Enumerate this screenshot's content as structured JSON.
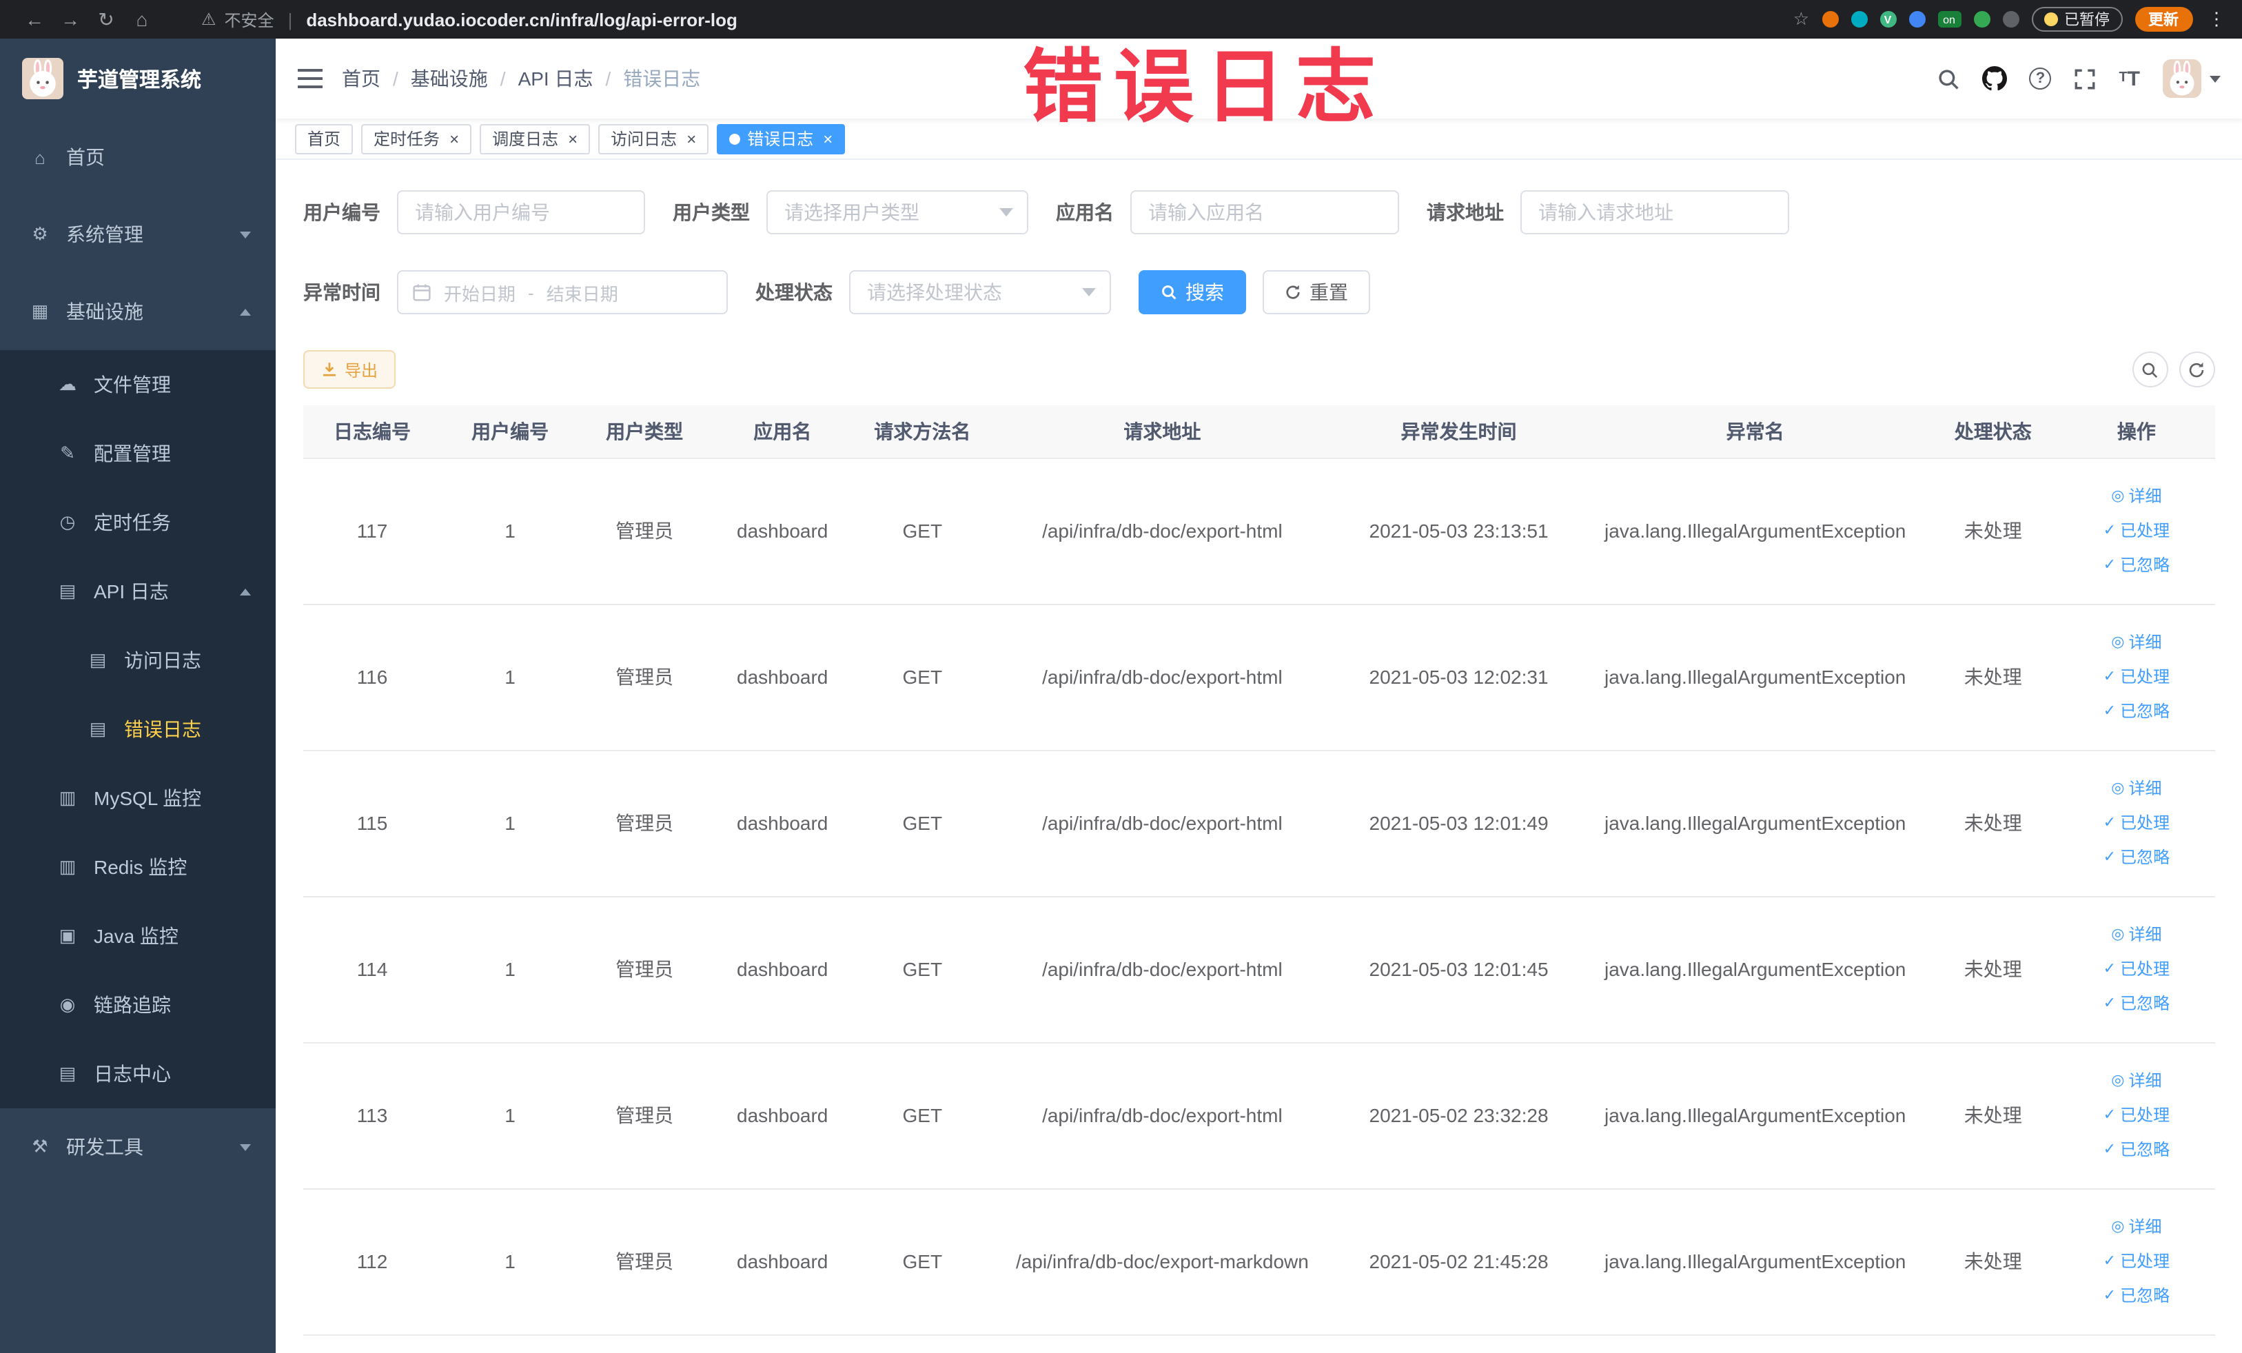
{
  "colors": {
    "accent": "#409eff",
    "watermark": "#f13a4e",
    "warning": "#e6a23c",
    "sidebar_bg": "#304156",
    "submenu_bg": "#1f2d3d",
    "menu_active": "#ffd04b"
  },
  "overlay": {
    "watermark": "错误日志"
  },
  "browser": {
    "security_label": "不安全",
    "url": "dashboard.yudao.iocoder.cn/infra/log/api-error-log",
    "extension_badge_on": "on",
    "paused_badge": "已暂停",
    "update_button": "更新"
  },
  "sidebar": {
    "logo_title": "芋道管理系统",
    "menu": [
      {
        "key": "home",
        "label": "首页",
        "icon": "home",
        "level": 1
      },
      {
        "key": "system-management",
        "label": "系统管理",
        "icon": "gear",
        "level": 1,
        "chevron": "down"
      },
      {
        "key": "infrastructure",
        "label": "基础设施",
        "icon": "grid",
        "level": 1,
        "chevron": "up"
      },
      {
        "key": "file-management",
        "label": "文件管理",
        "icon": "cloud",
        "level": 2,
        "sub": true
      },
      {
        "key": "config-management",
        "label": "配置管理",
        "icon": "edit",
        "level": 2,
        "sub": true
      },
      {
        "key": "scheduled-tasks",
        "label": "定时任务",
        "icon": "clock",
        "level": 2,
        "sub": true
      },
      {
        "key": "api-logs",
        "label": "API 日志",
        "icon": "doc",
        "level": 2,
        "sub": true,
        "chevron": "up"
      },
      {
        "key": "access-logs",
        "label": "访问日志",
        "icon": "doc",
        "level": 3,
        "sub": true
      },
      {
        "key": "error-logs",
        "label": "错误日志",
        "icon": "doc",
        "level": 3,
        "sub": true,
        "active": true
      },
      {
        "key": "mysql-monitor",
        "label": "MySQL 监控",
        "icon": "db",
        "level": 2,
        "sub": true
      },
      {
        "key": "redis-monitor",
        "label": "Redis 监控",
        "icon": "db",
        "level": 2,
        "sub": true
      },
      {
        "key": "java-monitor",
        "label": "Java 监控",
        "icon": "monitor",
        "level": 2,
        "sub": true
      },
      {
        "key": "link-tracing",
        "label": "链路追踪",
        "icon": "trace",
        "level": 2,
        "sub": true
      },
      {
        "key": "log-center",
        "label": "日志中心",
        "icon": "doc",
        "level": 2,
        "sub": true
      },
      {
        "key": "dev-tools",
        "label": "研发工具",
        "icon": "tool",
        "level": 1,
        "chevron": "down"
      }
    ]
  },
  "header": {
    "breadcrumb": [
      "首页",
      "基础设施",
      "API 日志",
      "错误日志"
    ]
  },
  "tabs": [
    {
      "key": "home",
      "label": "首页",
      "closable": false,
      "active": false
    },
    {
      "key": "scheduled-tasks",
      "label": "定时任务",
      "closable": true,
      "active": false
    },
    {
      "key": "schedule-logs",
      "label": "调度日志",
      "closable": true,
      "active": false
    },
    {
      "key": "access-logs",
      "label": "访问日志",
      "closable": true,
      "active": false
    },
    {
      "key": "error-logs",
      "label": "错误日志",
      "closable": true,
      "active": true
    }
  ],
  "filters": {
    "user_id": {
      "label": "用户编号",
      "placeholder": "请输入用户编号"
    },
    "user_type": {
      "label": "用户类型",
      "placeholder": "请选择用户类型"
    },
    "app_name": {
      "label": "应用名",
      "placeholder": "请输入应用名"
    },
    "request_url": {
      "label": "请求地址",
      "placeholder": "请输入请求地址"
    },
    "exception_time": {
      "label": "异常时间",
      "start": "开始日期",
      "separator": "-",
      "end": "结束日期"
    },
    "process_status": {
      "label": "处理状态",
      "placeholder": "请选择处理状态"
    }
  },
  "actions": {
    "search": "搜索",
    "reset": "重置",
    "export": "导出"
  },
  "table": {
    "columns": [
      "日志编号",
      "用户编号",
      "用户类型",
      "应用名",
      "请求方法名",
      "请求地址",
      "异常发生时间",
      "异常名",
      "处理状态",
      "操作"
    ],
    "rows": [
      {
        "log_id": "117",
        "user_id": "1",
        "user_type": "管理员",
        "app_name": "dashboard",
        "method": "GET",
        "url": "/api/infra/db-doc/export-html",
        "time": "2021-05-03 23:13:51",
        "exception": "java.lang.IllegalArgumentException",
        "status": "未处理"
      },
      {
        "log_id": "116",
        "user_id": "1",
        "user_type": "管理员",
        "app_name": "dashboard",
        "method": "GET",
        "url": "/api/infra/db-doc/export-html",
        "time": "2021-05-03 12:02:31",
        "exception": "java.lang.IllegalArgumentException",
        "status": "未处理"
      },
      {
        "log_id": "115",
        "user_id": "1",
        "user_type": "管理员",
        "app_name": "dashboard",
        "method": "GET",
        "url": "/api/infra/db-doc/export-html",
        "time": "2021-05-03 12:01:49",
        "exception": "java.lang.IllegalArgumentException",
        "status": "未处理"
      },
      {
        "log_id": "114",
        "user_id": "1",
        "user_type": "管理员",
        "app_name": "dashboard",
        "method": "GET",
        "url": "/api/infra/db-doc/export-html",
        "time": "2021-05-03 12:01:45",
        "exception": "java.lang.IllegalArgumentException",
        "status": "未处理"
      },
      {
        "log_id": "113",
        "user_id": "1",
        "user_type": "管理员",
        "app_name": "dashboard",
        "method": "GET",
        "url": "/api/infra/db-doc/export-html",
        "time": "2021-05-02 23:32:28",
        "exception": "java.lang.IllegalArgumentException",
        "status": "未处理"
      },
      {
        "log_id": "112",
        "user_id": "1",
        "user_type": "管理员",
        "app_name": "dashboard",
        "method": "GET",
        "url": "/api/infra/db-doc/export-markdown",
        "time": "2021-05-02 21:45:28",
        "exception": "java.lang.IllegalArgumentException",
        "status": "未处理"
      }
    ],
    "row_actions": [
      {
        "label": "详细",
        "icon": "eye"
      },
      {
        "label": "已处理",
        "icon": "check"
      },
      {
        "label": "已忽略",
        "icon": "check"
      }
    ]
  }
}
